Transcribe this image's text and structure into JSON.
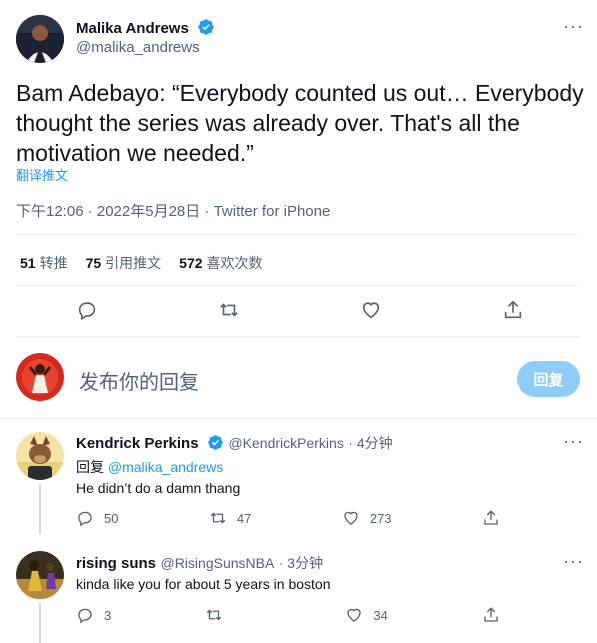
{
  "tweet": {
    "author_name": "Malika Andrews",
    "author_handle": "@malika_andrews",
    "more_label": "···",
    "text": "Bam Adebayo: “Everybody counted us out… Everybody thought the series was already over. That's all the motivation we needed.”",
    "translate_label": "翻译推文",
    "timestamp": "下午12:06 · 2022年5月28日 · Twitter for iPhone",
    "stats": {
      "retweets_count": "51",
      "retweets_label": "转推",
      "quotes_count": "75",
      "quotes_label": "引用推文",
      "likes_count": "572",
      "likes_label": "喜欢次数"
    }
  },
  "composer": {
    "placeholder": "发布你的回复",
    "reply_button": "回复"
  },
  "replies": [
    {
      "name": "Kendrick Perkins",
      "handle": "@KendrickPerkins",
      "time": "· 4分钟",
      "reply_to_label": "回复",
      "reply_to_handle": "@malika_andrews",
      "text": "He didn’t do a damn thang",
      "reply_count": "50",
      "retweet_count": "47",
      "like_count": "273"
    },
    {
      "name": "rising suns",
      "handle": "@RisingSunsNBA",
      "time": "· 3分钟",
      "text": "kinda like you for about 5 years in boston",
      "reply_count": "3",
      "retweet_count": "",
      "like_count": "34"
    }
  ],
  "icons": {
    "reply": "reply-icon",
    "retweet": "retweet-icon",
    "like": "heart-icon",
    "share": "share-icon",
    "verified": "verified-badge-icon"
  },
  "colors": {
    "accent": "#1d9bf0",
    "reply_button_disabled": "#8ecdf8",
    "secondary_text": "#536471"
  }
}
